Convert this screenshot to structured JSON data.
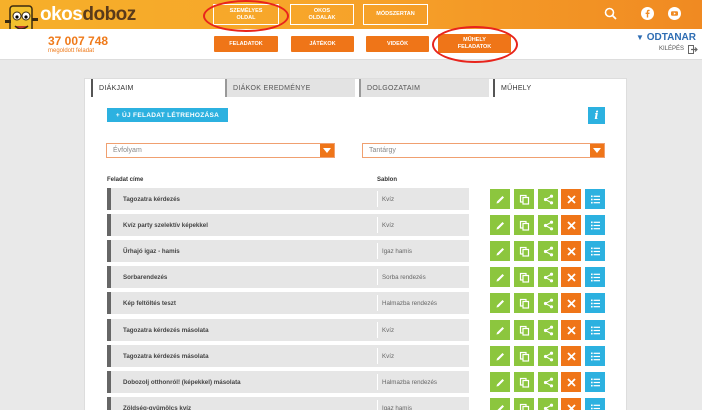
{
  "logo": {
    "light": "okos",
    "dark": "doboz"
  },
  "topnav": [
    {
      "line1": "SZEMÉLYES",
      "line2": "OLDAL"
    },
    {
      "line1": "OKOS",
      "line2": "OLDALAK"
    },
    {
      "line1": "MÓDSZERTAN",
      "line2": ""
    }
  ],
  "stats": {
    "count": "37 007 748",
    "label": "megoldott feladat"
  },
  "subnav": [
    {
      "line1": "FELADATOK",
      "line2": ""
    },
    {
      "line1": "JÁTÉKOK",
      "line2": ""
    },
    {
      "line1": "VIDEÓK",
      "line2": ""
    },
    {
      "line1": "MŰHELY",
      "line2": "FELADATOK"
    }
  ],
  "user": {
    "name": "ODTANAR",
    "logout": "KILÉPÉS"
  },
  "tabs": [
    "DIÁKJAIM",
    "DIÁKOK EREDMÉNYE",
    "DOLGOZATAIM",
    "MŰHELY"
  ],
  "new_task": "+ ÚJ FELADAT LÉTREHOZÁSA",
  "info": "i",
  "filters": {
    "grade": "Évfolyam",
    "subject": "Tantárgy"
  },
  "columns": {
    "title": "Feladat címe",
    "template": "Sablon"
  },
  "rows": [
    {
      "title": "Tagozatra kérdezés",
      "template": "Kvíz"
    },
    {
      "title": "Kvíz party szelektív képekkel",
      "template": "Kvíz"
    },
    {
      "title": "Űrhajó igaz - hamis",
      "template": "Igaz hamis"
    },
    {
      "title": "Sorbarendezés",
      "template": "Sorba rendezés"
    },
    {
      "title": "Kép feltöltés teszt",
      "template": "Halmazba rendezés"
    },
    {
      "title": "Tagozatra kérdezés másolata",
      "template": "Kvíz"
    },
    {
      "title": "Tagozatra kérdezés másolata",
      "template": "Kvíz"
    },
    {
      "title": "Dobozolj otthonról! (képekkel) másolata",
      "template": "Halmazba rendezés"
    },
    {
      "title": "Zöldség-gyümölcs kvíz",
      "template": "Igaz hamis"
    }
  ],
  "colors": {
    "orange": "#ef7518",
    "green": "#8cc63e",
    "blue": "#2cb1e0",
    "annotation": "#e8241c"
  },
  "icons": {
    "row_actions": [
      "pencil-icon",
      "copy-icon",
      "share-icon",
      "close-icon",
      "list-icon"
    ],
    "top": [
      "search-icon",
      "facebook-icon",
      "youtube-icon"
    ]
  }
}
